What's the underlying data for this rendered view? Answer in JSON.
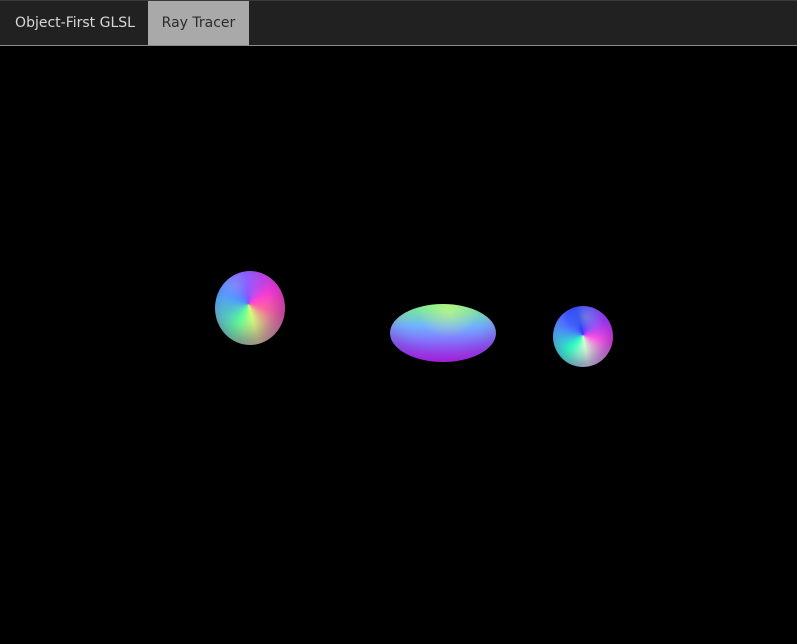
{
  "tabs": [
    {
      "label": "Object-First GLSL",
      "active": false
    },
    {
      "label": "Ray Tracer",
      "active": true
    }
  ],
  "viewport": {
    "background": "#000000",
    "objects": [
      {
        "kind": "sphere",
        "icon": "sphere-icon"
      },
      {
        "kind": "ellipsoid",
        "icon": "ellipsoid-icon"
      },
      {
        "kind": "sphere",
        "icon": "sphere-icon"
      }
    ]
  },
  "colors": {
    "tabbar": "#212121",
    "active_tab": "#a9a9a9",
    "inactive_text": "#d8d8d8",
    "active_text": "#2b2b2b"
  }
}
